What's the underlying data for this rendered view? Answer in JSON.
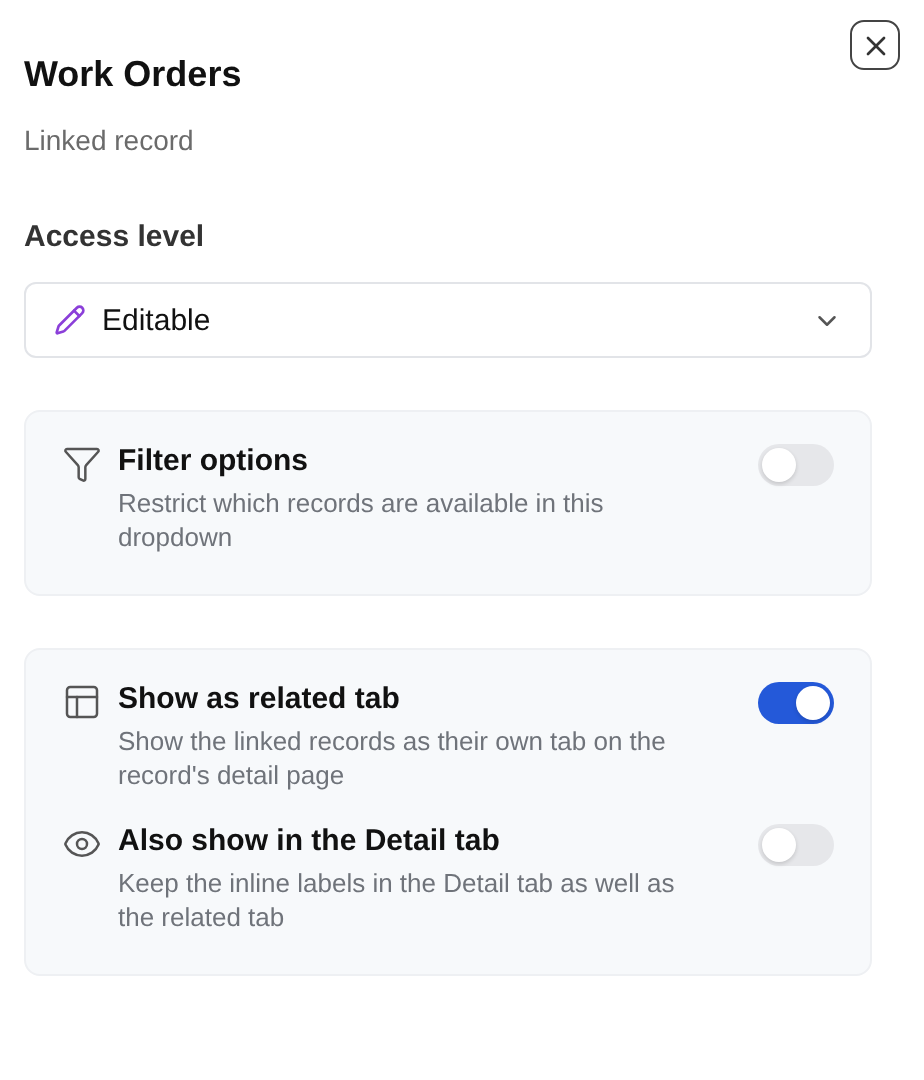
{
  "panel": {
    "title": "Work Orders",
    "subtitle": "Linked record"
  },
  "access": {
    "label": "Access level",
    "value": "Editable"
  },
  "sections": [
    {
      "items": [
        {
          "title": "Filter options",
          "description": "Restrict which records are available in this dropdown",
          "on": false
        }
      ]
    },
    {
      "items": [
        {
          "title": "Show as related tab",
          "description": "Show the linked records as their own tab on the record's detail page",
          "on": true
        },
        {
          "title": "Also show in the Detail tab",
          "description": "Keep the inline labels in the Detail tab as well as the related tab",
          "on": false
        }
      ]
    }
  ]
}
